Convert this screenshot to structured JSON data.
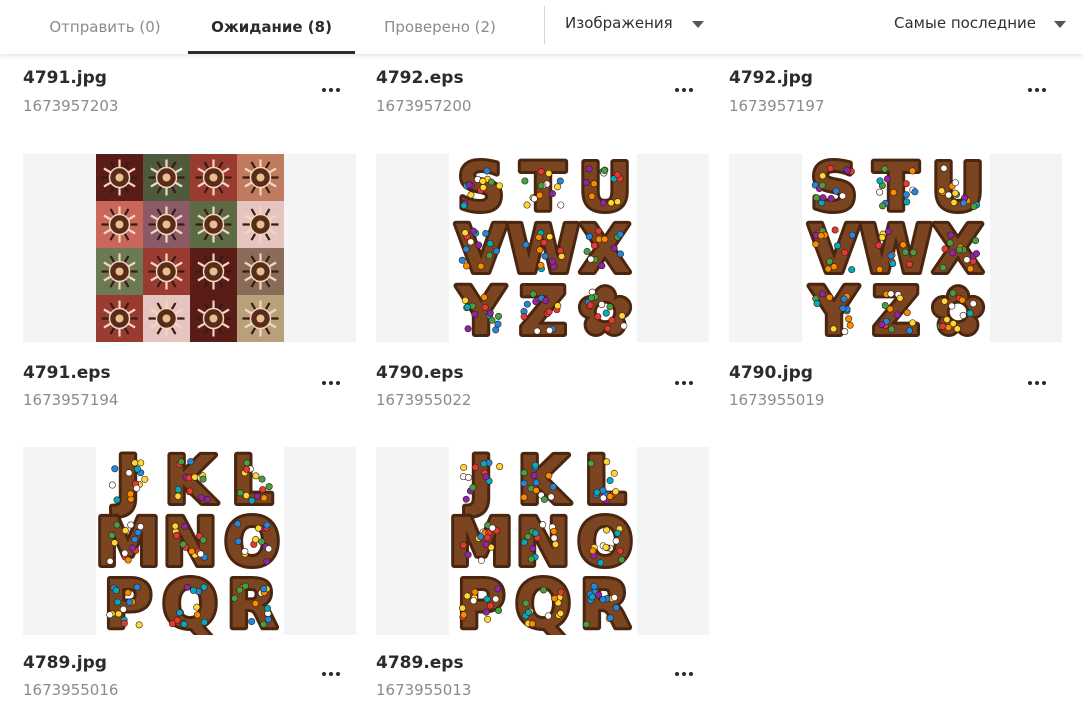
{
  "tabs": [
    {
      "label": "Отправить (0)"
    },
    {
      "label": "Ожидание (8)"
    },
    {
      "label": "Проверено (2)"
    }
  ],
  "filters": {
    "type_label": "Изображения",
    "sort_label": "Самые последние"
  },
  "items": [
    {
      "name": "4791.jpg",
      "id": "1673957203"
    },
    {
      "name": "4792.eps",
      "id": "1673957200"
    },
    {
      "name": "4792.jpg",
      "id": "1673957197"
    },
    {
      "name": "4791.eps",
      "id": "1673957194"
    },
    {
      "name": "4790.eps",
      "id": "1673955022"
    },
    {
      "name": "4790.jpg",
      "id": "1673955019"
    },
    {
      "name": "4789.jpg",
      "id": "1673955016"
    },
    {
      "name": "4789.eps",
      "id": "1673955013"
    }
  ],
  "thumbnails": {
    "row1": [
      "pattern",
      "letters-STUVWXYZ",
      "letters-STUVWXYZ"
    ],
    "row2": [
      "letters-JKLMNOPQR",
      "letters-JKLMNOPQR"
    ],
    "letters_a": [
      "S",
      "T",
      "U",
      "V",
      "W",
      "X",
      "Y",
      "Z",
      "✿"
    ],
    "letters_b": [
      "J",
      "K",
      "L",
      "M",
      "N",
      "O",
      "P",
      "Q",
      "R"
    ]
  },
  "colors": {
    "active_tab": "#2b2b2b",
    "inactive_tab": "#8b8b8b",
    "thumb_bg": "#f3f4f6",
    "chocolate": "#7a4520",
    "chocolate_dark": "#4a2610",
    "pattern_tiles": [
      "#5a1c17",
      "#4f5a3c",
      "#9a3b32",
      "#c07a5e",
      "#c9685a",
      "#8b5a66",
      "#5d6b45",
      "#e6c5c0",
      "#6b7a52",
      "#9a3b32",
      "#5a1c17",
      "#8a6b5a",
      "#9a3b32",
      "#e6c5c0",
      "#5a1c17",
      "#b8a07a"
    ]
  }
}
